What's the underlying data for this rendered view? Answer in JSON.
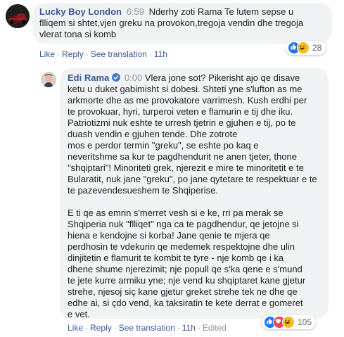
{
  "comment1": {
    "author": "Lucky Boy London",
    "time": "6:59",
    "text_lines": [
      "Nderhy zoti Rama Te lutem sepse u",
      "flliqem si shtet,vjen greku na provokon,tregoja vendin dhe tregoja",
      "vlerat tona si komb"
    ],
    "actions": {
      "like": "Like",
      "reply": "Reply",
      "see_translation": "See translation",
      "age": "11h"
    },
    "reactions": {
      "count": "28",
      "types": [
        "like-icon",
        "haha-icon"
      ]
    }
  },
  "comment2": {
    "author": "Edi Rama",
    "time": "0:00",
    "paragraph1_lines": [
      "Vlera jone sot? Pikerisht ajo qe disave",
      "ketu u duket gabimisht si dobesi. Shteti yne s'lufton as me",
      "arkmorte dhe as me provokatore varrimesh. Kush erdhi per",
      "te provokuar, hyri, turperoi veten e flamurin e tij dhe iku.",
      "Patriotizmi nuk eshte te urresh tjetrin e gjuhen e tij, po te",
      "duash vendin e gjuhen tende. Dhe zotrote",
      "mos e perdor termin \"greku\", se eshte po kaq e",
      "neveritshme sa kur te pagdhendurit ne anen tjeter, thone",
      "\"shqiptari\"! Minoriteti grek, njerezit e mire te minoritetit e te",
      "Bularatit, nuk jane \"greku\", po jane qytetare te respektuar e te",
      "te pazevendesueshem te Shqiperise."
    ],
    "paragraph2_lines": [
      "E ti qe as emrin s'merret vesh si e ke, rri pa merak se",
      "Shqiperia nuk \"flliqet\" nga ca te pagdhendur, qe jetojne si",
      "hiena e kendojne si korba! Jane qenie te mjera qe",
      "perdhosin te vdekurin qe medemek respektojne dhe ulin",
      "dinjitetin e flamurit te kombit te tyre - nje komb qe i ka",
      "dhene shume njerezimit; nje popull qe s'ka qene e s'mund",
      "te jete kurre armiku yne; nje vend ku shqiptaret kane gjetur",
      "strehe, njesoj siç kane gjetur greket strehe tek ne dhe qe",
      "edhe ai, si çdo vend, ka taksiratin te kete derrat e gomeret",
      "e vet."
    ],
    "actions": {
      "like": "Like",
      "reply": "Reply",
      "see_translation": "See translation",
      "age": "11h",
      "edited": "Edited"
    },
    "reactions": {
      "count": "105",
      "types": [
        "like-icon",
        "love-icon",
        "haha-icon"
      ]
    }
  },
  "colors": {
    "link": "#385898",
    "muted": "#90949c",
    "bubble": "#f2f3f5",
    "like": "#1877f2",
    "love": "#f33e58",
    "haha": "#f7b928"
  }
}
